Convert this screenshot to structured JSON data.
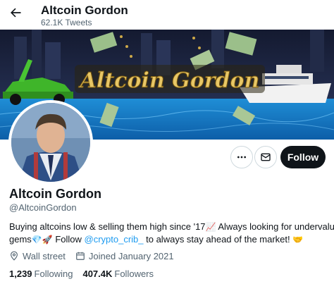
{
  "header": {
    "title": "Altcoin Gordon",
    "tweet_count": "62.1K Tweets"
  },
  "banner": {
    "text": "Altcoin Gordon",
    "colors": {
      "sky": "#1c2440",
      "water": "#1f8ed6",
      "gold": "#d8b14a",
      "car": "#3fb52a"
    }
  },
  "actions": {
    "follow_label": "Follow"
  },
  "profile": {
    "display_name": "Altcoin Gordon",
    "handle": "@AltcoinGordon",
    "bio_line1": "Buying altcoins low & selling them high since '17",
    "bio_line1_tail": " Always looking for undervalued",
    "bio_line2_start": "gems",
    "bio_line2_follow": " Follow ",
    "bio_link": "@crypto_crib_",
    "bio_line2_end": " to always stay ahead of the market!",
    "location": "Wall street",
    "joined": "Joined January 2021"
  },
  "stats": {
    "following_count": "1,239",
    "following_label": "Following",
    "followers_count": "407.4K",
    "followers_label": "Followers"
  },
  "colors": {
    "accent": "#1d9bf0",
    "text": "#0f1419",
    "muted": "#536471"
  }
}
